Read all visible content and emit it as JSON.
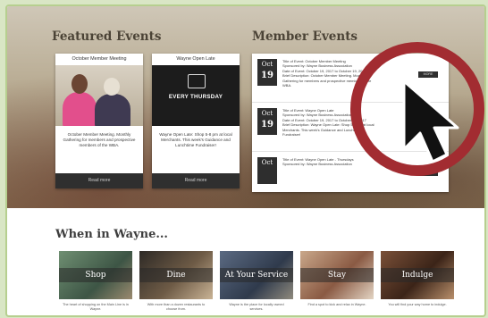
{
  "featured": {
    "title": "Featured Events",
    "cards": [
      {
        "title": "October Member Meeting",
        "description": "October Member Meeting. Monthly Gathering for members and prospective members of the WBA.",
        "button": "Read more"
      },
      {
        "title": "Wayne Open Late",
        "image_text": "EVERY THURSDAY",
        "description": "Wayne Open Late: Shop 5-8 pm at local Merchants. This week's Guidance and Lunchtime Fundraiser!",
        "button": "Read more"
      }
    ]
  },
  "member_events": {
    "title": "Member Events",
    "events": [
      {
        "month": "Oct",
        "day": "19",
        "lines": [
          "Title of Event: October Member Meeting",
          "Sponsored by: Wayne Business Association",
          "Date of Event: October 19, 2017 to October 19, 2017",
          "Brief Description: October Member Meeting. Monthly",
          "Gathering for members and prospective members of the",
          "WBA."
        ],
        "button": "MORE"
      },
      {
        "month": "Oct",
        "day": "19",
        "lines": [
          "Title of Event: Wayne Open Late",
          "Sponsored by: Wayne Business Association",
          "Date of Event: October 19, 2017 to October 19, 2017",
          "Brief Description: Wayne Open Late: Shop 5-8 pm at local",
          "Merchants. This week's Guidance and Lunchtime",
          "Fundraiser!"
        ],
        "button": "MORE"
      },
      {
        "month": "Oct",
        "day": "",
        "lines": [
          "Title of Event: Wayne Open Late - Thursdays",
          "Sponsored by: Wayne Business Association"
        ],
        "button": "MORE"
      }
    ]
  },
  "when_in_wayne": {
    "title": "When in Wayne...",
    "tiles": [
      {
        "label": "Shop",
        "caption": "The heart of shopping on the Main Line is in Wayne."
      },
      {
        "label": "Dine",
        "caption": "With more than a dozen restaurants to choose from."
      },
      {
        "label": "At Your Service",
        "caption": "Wayne is the place for locally owned services."
      },
      {
        "label": "Stay",
        "caption": "Find a spot to kick and relax in Wayne."
      },
      {
        "label": "Indulge",
        "caption": "You will find your way home to indulge."
      }
    ]
  },
  "colors": {
    "accent_circle": "#a22c31",
    "button_dark": "#2f2f2f",
    "frame_border": "#b6cf8f"
  },
  "icons": {
    "cursor": "cursor-arrow-icon"
  }
}
